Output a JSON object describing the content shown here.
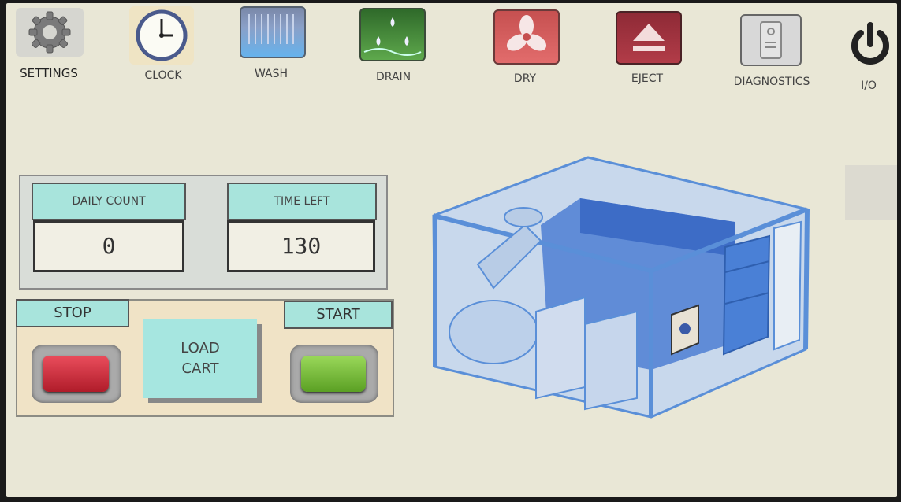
{
  "toolbar": {
    "settings": {
      "label": "SETTINGS",
      "icon": "gear-icon"
    },
    "clock": {
      "label": "CLOCK",
      "icon": "clock-icon"
    },
    "wash": {
      "label": "WASH",
      "icon": "wash-icon"
    },
    "drain": {
      "label": "DRAIN",
      "icon": "drain-icon"
    },
    "dry": {
      "label": "DRY",
      "icon": "fan-icon"
    },
    "eject": {
      "label": "EJECT",
      "icon": "eject-icon"
    },
    "diagnostics": {
      "label": "DIAGNOSTICS",
      "icon": "diagnostics-icon"
    },
    "power": {
      "label": "I/O",
      "icon": "power-icon"
    }
  },
  "counters": {
    "daily_count_label": "DAILY COUNT",
    "daily_count_value": "0",
    "time_left_label": "TIME LEFT",
    "time_left_value": "130"
  },
  "controls": {
    "stop_label": "STOP",
    "start_label": "START",
    "load_cart_line1": "LOAD",
    "load_cart_line2": "CART"
  },
  "colors": {
    "background": "#e9e7d6",
    "teal": "#a8e4dc",
    "stop": "#d8283a",
    "start": "#7cc23a",
    "machine": "#5a8fd8"
  }
}
